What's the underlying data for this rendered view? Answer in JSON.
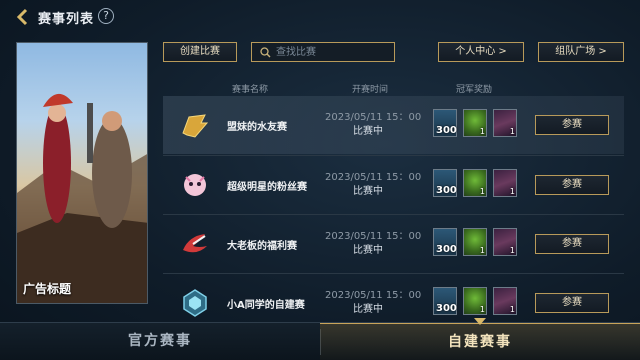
{
  "header": {
    "title": "赛事列表",
    "help_icon": "?"
  },
  "ad": {
    "label": "广告标题"
  },
  "toolbar": {
    "create_label": "创建比赛",
    "search_placeholder": "查找比赛",
    "profile_label": "个人中心 >",
    "team_label": "组队广场 >"
  },
  "columns": {
    "name": "赛事名称",
    "time": "开赛时间",
    "reward": "冠军奖励"
  },
  "rows": [
    {
      "name": "盟妹的水友赛",
      "date": "2023/05/11 15：00",
      "status": "比赛中",
      "reward_count_1": "300",
      "reward_count_2": "1",
      "reward_count_3": "1",
      "join": "参赛"
    },
    {
      "name": "超级明星的粉丝赛",
      "date": "2023/05/11 15：00",
      "status": "比赛中",
      "reward_count_1": "300",
      "reward_count_2": "1",
      "reward_count_3": "1",
      "join": "参赛"
    },
    {
      "name": "大老板的福利赛",
      "date": "2023/05/11 15：00",
      "status": "比赛中",
      "reward_count_1": "300",
      "reward_count_2": "1",
      "reward_count_3": "1",
      "join": "参赛"
    },
    {
      "name": "小A同学的自建赛",
      "date": "2023/05/11 15：00",
      "status": "比赛中",
      "reward_count_1": "300",
      "reward_count_2": "1",
      "reward_count_3": "1",
      "join": "参赛"
    }
  ],
  "tabs": {
    "official": "官方赛事",
    "custom": "自建赛事"
  },
  "colors": {
    "accent_gold": "#b89a5a",
    "active_tab": "#f2e3bd"
  },
  "icons": [
    "back-arrow-icon",
    "help-icon",
    "search-icon",
    "tournament-logo-icon",
    "crystal-reward-icon",
    "orb-reward-icon",
    "champion-portrait-icon"
  ]
}
